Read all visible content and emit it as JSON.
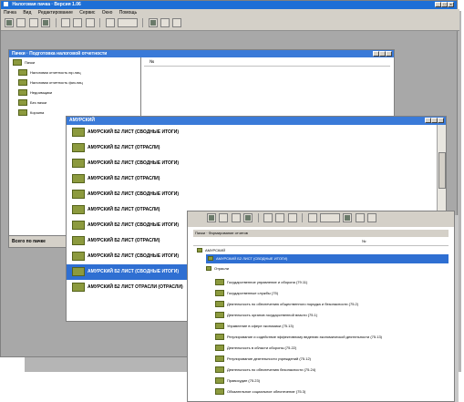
{
  "main_window": {
    "title": "Налоговая пачка · Версия 1.06",
    "menu": [
      "Пачка",
      "Вид",
      "Редактирование",
      "Сервис",
      "Окно",
      "Помощь"
    ],
    "window_controls": [
      "_",
      "□",
      "×"
    ]
  },
  "child_window": {
    "title": "Пачки · Подготовка налоговой отчетности",
    "column_header": "№",
    "tree": [
      "Пачки",
      "Налоговая отчетность юр.лиц",
      "Налоговая отчетность физ.лиц",
      "Недоимщики",
      "Без пачки",
      "Корзина"
    ],
    "status_text": "Всего по пачке"
  },
  "list_window": {
    "title": "АМУРСКИЙ",
    "items": [
      "АМУРСКИЙ Б2 ЛИСТ (СВОДНЫЕ ИТОГИ)",
      "АМУРСКИЙ Б2 ЛИСТ (ОТРАСЛИ)",
      "АМУРСКИЙ Б2 ЛИСТ (СВОДНЫЕ ИТОГИ)",
      "АМУРСКИЙ Б2 ЛИСТ (ОТРАСЛИ)",
      "АМУРСКИЙ Б2 ЛИСТ (СВОДНЫЕ ИТОГИ)",
      "АМУРСКИЙ Б2 ЛИСТ (ОТРАСЛИ)",
      "АМУРСКИЙ Б2 ЛИСТ (СВОДНЫЕ ИТОГИ)",
      "АМУРСКИЙ Б2 ЛИСТ (ОТРАСЛИ)",
      "АМУРСКИЙ Б2 ЛИСТ (СВОДНЫЕ ИТОГИ)",
      "АМУРСКИЙ Б2 ЛИСТ (СВОДНЫЕ ИТОГИ)",
      "АМУРСКИЙ Б2 ЛИСТ ОТРАСЛИ (ОТРАСЛИ)"
    ],
    "selected_index": 9
  },
  "tree_window": {
    "header_label": "Пачки · Формирование отчетов",
    "column_header": "№",
    "root": "АМУРСКИЙ",
    "selected_node": "АМУРСКИЙ Б2 ЛИСТ (СВОДНЫЕ ИТОГИ)",
    "group": "Отрасли",
    "items": [
      "Государственное управление и оборона (79.11)",
      "Государственные службы (75)",
      "Деятельность по обеспечению общественного порядка и безопасности (75.2)",
      "Деятельность органов государственной власти (75.1)",
      "Управление в сфере экономики (75.13)",
      "Регулирование и содействие эффективному ведению экономической деятельности (75.13)",
      "Деятельность в области обороны (75.22)",
      "Регулирование деятельности учреждений (75.12)",
      "Деятельность по обеспечению безопасности (75.24)",
      "Правосудие (75.23)",
      "Обязательное социальное обеспечение (75.3)"
    ]
  }
}
